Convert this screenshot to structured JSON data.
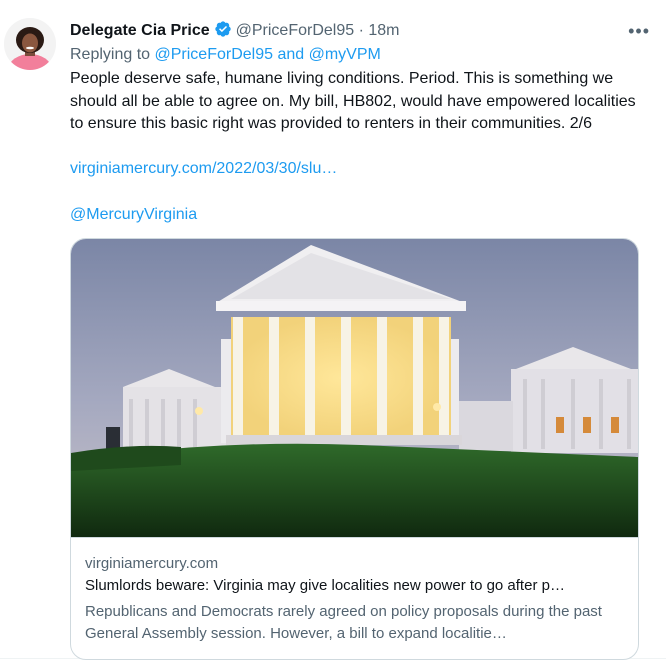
{
  "author": {
    "name": "Delegate Cia Price",
    "handle": "@PriceForDel95",
    "separator": "·",
    "time": "18m",
    "verified_icon": "verified-badge-icon"
  },
  "more_label": "•••",
  "reply": {
    "prefix": "Replying to",
    "targets": "@PriceForDel95 and @myVPM"
  },
  "tweet": {
    "text": "People deserve safe, humane living conditions. Period. This is something we should all be able to agree on. My bill, HB802, would have empowered localities to ensure this basic right was provided to renters in their communities.  2/6",
    "url": "virginiamercury.com/2022/03/30/slu…",
    "mention": "@MercuryVirginia"
  },
  "card": {
    "domain": "virginiamercury.com",
    "title": "Slumlords beware: Virginia may give localities new power to go after p…",
    "description": "Republicans and Democrats rarely agreed on policy proposals during the past General Assembly session. However, a bill to expand localitie…"
  },
  "colors": {
    "link": "#1d9bf0",
    "muted": "#536471",
    "text": "#0f1419",
    "border": "#cfd9de"
  }
}
